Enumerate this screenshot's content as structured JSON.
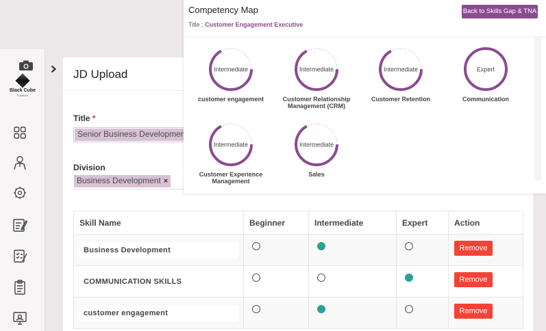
{
  "sidebar": {
    "logo_text": "Black Cube",
    "logo_sub": "Solutions"
  },
  "main": {
    "title": "JD Upload",
    "title_field": {
      "label": "Title",
      "required": "*",
      "value": "Senior Business Development"
    },
    "division_field": {
      "label": "Division",
      "tag": "Business Development",
      "remove": "×"
    }
  },
  "table": {
    "headers": [
      "Skill Name",
      "Beginner",
      "Intermediate",
      "Expert",
      "Action"
    ],
    "rows": [
      {
        "skill": "Business Development",
        "level": "intermediate",
        "action": "Remove"
      },
      {
        "skill": "COMMUNICATION SKILLS",
        "level": "expert",
        "action": "Remove"
      },
      {
        "skill": "customer engagement",
        "level": "intermediate",
        "action": "Remove"
      }
    ]
  },
  "modal": {
    "title": "Competency Map",
    "subtitle_label": "Title : ",
    "subtitle_value": "Customer Engagement Executive",
    "back_button": "Back to Skills Gap & TNA",
    "accent": "#8b4b8f",
    "competencies": [
      {
        "name": "customer engagement",
        "level": "Intermediate",
        "progress": 0.67
      },
      {
        "name": "Customer Relationship Management (CRM)",
        "level": "Intermediate",
        "progress": 0.67
      },
      {
        "name": "Customer Retention",
        "level": "Intermediate",
        "progress": 0.67
      },
      {
        "name": "Communication",
        "level": "Expert",
        "progress": 1.0
      },
      {
        "name": "Customer Experience Management",
        "level": "Intermediate",
        "progress": 0.67
      },
      {
        "name": "Sales",
        "level": "Intermediate",
        "progress": 0.67
      }
    ]
  }
}
